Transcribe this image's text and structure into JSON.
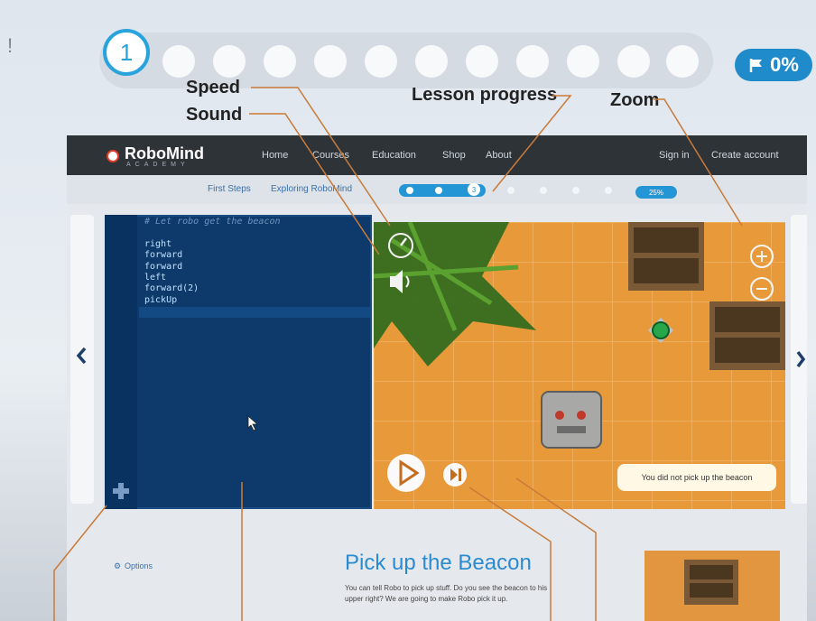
{
  "edge_mark": "!",
  "stepper": {
    "current": "1",
    "badge_value": "0%"
  },
  "annotations": {
    "speed": "Speed",
    "sound": "Sound",
    "lesson_progress": "Lesson progress",
    "zoom": "Zoom"
  },
  "app": {
    "logo": "RoboMind",
    "logo_sub": "ACADEMY",
    "nav": [
      "Home",
      "Courses",
      "Education",
      "Shop",
      "About"
    ],
    "auth": [
      "Sign in",
      "Create account"
    ],
    "breadcrumb": [
      "First Steps",
      "Exploring RoboMind"
    ],
    "mini_progress": {
      "step": "3",
      "badge": "25%"
    },
    "code": {
      "comment": "# Let robo get the beacon",
      "lines": [
        "right",
        "forward",
        "forward",
        "left",
        "forward(2)",
        "pickUp"
      ]
    },
    "message": "You did not pick up the beacon",
    "options_label": "Options",
    "lesson": {
      "title": "Pick up the Beacon",
      "text_1": "You can tell Robo to pick up stuff. Do you see the beacon to his",
      "text_2": "upper right? We are going to make Robo pick it up."
    }
  },
  "colors": {
    "accent": "#29a3dc",
    "badge": "#1f8bcb",
    "editor": "#0d3a6a",
    "game_floor": "#e89a3a",
    "nav_bar": "#2e3338"
  },
  "icons": [
    "flag-icon",
    "speed-icon",
    "sound-icon",
    "zoom-in-icon",
    "zoom-out-icon",
    "play-icon",
    "step-icon",
    "chevron-left-icon",
    "chevron-right-icon",
    "add-icon",
    "beacon-icon",
    "robot-icon",
    "mouse-cursor-icon"
  ]
}
